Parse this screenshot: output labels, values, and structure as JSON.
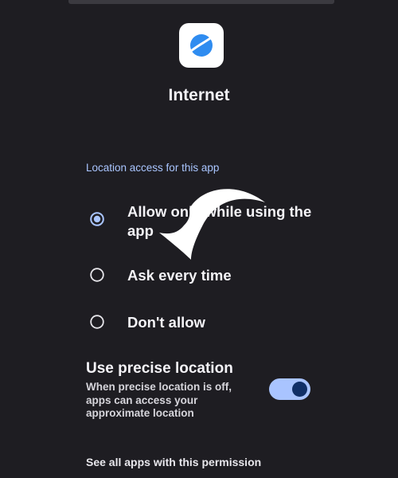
{
  "app": {
    "name": "Internet",
    "icon": "internet-planet-icon"
  },
  "permission": {
    "section_label": "Location access for this app",
    "options": [
      {
        "label": "Allow only while using the app",
        "selected": true
      },
      {
        "label": "Ask every time",
        "selected": false
      },
      {
        "label": "Don't allow",
        "selected": false
      }
    ]
  },
  "precise_location": {
    "title": "Use precise location",
    "description": "When precise location is off, apps can access your approximate location",
    "enabled": true
  },
  "see_all_link": "See all apps with this permission",
  "annotation": {
    "icon": "curved-arrow-icon"
  },
  "colors": {
    "background": "#1e1d22",
    "accent": "#a9c5ff",
    "toggle_knob": "#102f66",
    "app_icon_blue": "#2f8cf0"
  }
}
